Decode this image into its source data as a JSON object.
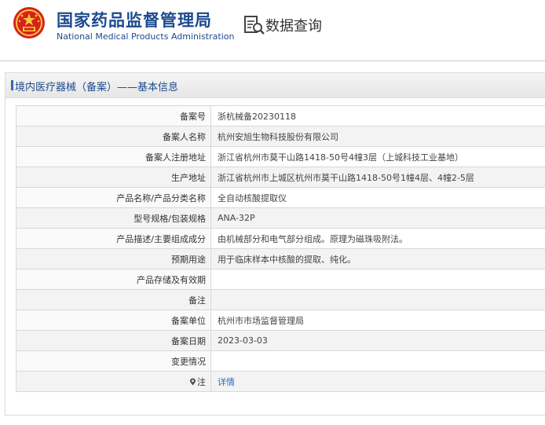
{
  "header": {
    "title_cn": "国家药品监督管理局",
    "title_en": "National Medical Products Administration",
    "query_label": "数据查询",
    "emblem_icon": "national-emblem-icon",
    "query_icon": "data-query-icon",
    "accent_color": "#1c4a8f",
    "emblem_color": "#d8211d"
  },
  "panel": {
    "title": "境内医疗器械（备案）——基本信息"
  },
  "rows": [
    {
      "label": "备案号",
      "value": "浙杭械备20230118"
    },
    {
      "label": "备案人名称",
      "value": "杭州安旭生物科技股份有限公司"
    },
    {
      "label": "备案人注册地址",
      "value": "浙江省杭州市莫干山路1418-50号4幢3层（上城科技工业基地）"
    },
    {
      "label": "生产地址",
      "value": "浙江省杭州市上城区杭州市莫干山路1418-50号1幢4层、4幢2-5层"
    },
    {
      "label": "产品名称/产品分类名称",
      "value": "全自动核酸提取仪"
    },
    {
      "label": "型号规格/包装规格",
      "value": "ANA-32P"
    },
    {
      "label": "产品描述/主要组成成分",
      "value": "由机械部分和电气部分组成。原理为磁珠吸附法。"
    },
    {
      "label": "预期用途",
      "value": "用于临床样本中核酸的提取、纯化。"
    },
    {
      "label": "产品存储及有效期",
      "value": ""
    },
    {
      "label": "备注",
      "value": ""
    },
    {
      "label": "备案单位",
      "value": "杭州市市场监督管理局"
    },
    {
      "label": "备案日期",
      "value": "2023-03-03"
    },
    {
      "label": "变更情况",
      "value": ""
    }
  ],
  "note_row": {
    "label": "注",
    "link_text": "详情",
    "icon": "location-pin-icon",
    "link_color": "#2a6bc1"
  }
}
